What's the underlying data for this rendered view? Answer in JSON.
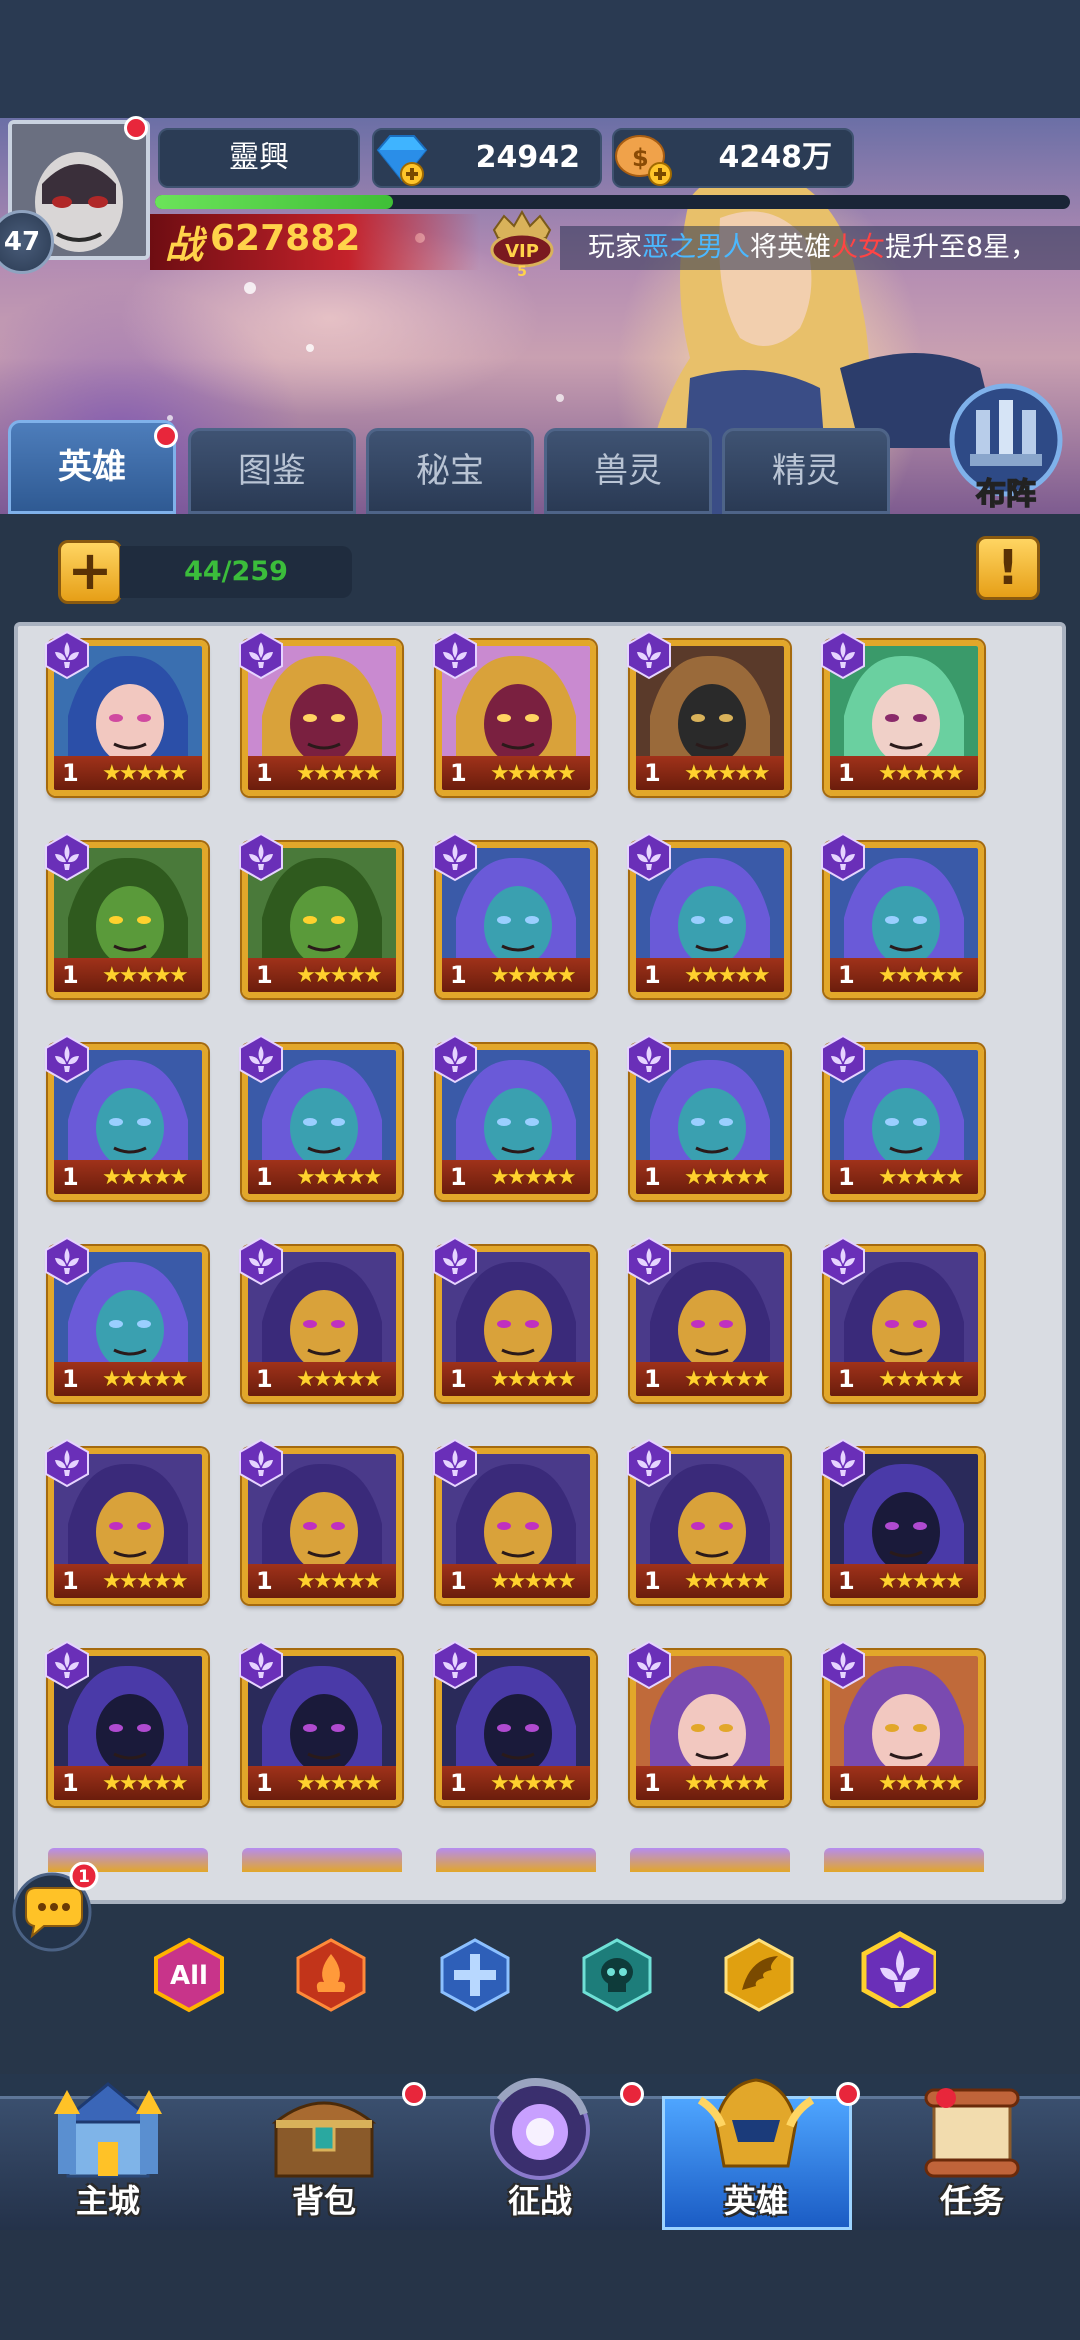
{
  "player": {
    "name": "靈興",
    "level": "47",
    "diamonds": "24942",
    "gold": "4248万",
    "power_label": "战",
    "power": "627882",
    "vip": "VIP",
    "vip_level": "5",
    "xp_fraction": 0.26
  },
  "ticker": {
    "prefix": "玩家",
    "player": "恶之男人",
    "middle": "将英雄",
    "hero": "火女",
    "suffix": "提升至8星，"
  },
  "tabs": [
    {
      "label": "英雄",
      "active": true,
      "badge": true
    },
    {
      "label": "图鉴",
      "active": false
    },
    {
      "label": "秘宝",
      "active": false
    },
    {
      "label": "兽灵",
      "active": false
    },
    {
      "label": "精灵",
      "active": false
    }
  ],
  "formation_label": "布阵",
  "hero_count": "44/259",
  "hero_grid": [
    [
      "naga-sorceress",
      "gold-mask-assassin",
      "gold-mask-assassin",
      "armored-knight",
      "green-haired-dryad"
    ],
    [
      "swamp-toad",
      "swamp-toad",
      "feather-witch",
      "feather-witch",
      "feather-witch"
    ],
    [
      "feather-witch",
      "feather-witch",
      "feather-witch",
      "feather-witch",
      "feather-witch"
    ],
    [
      "feather-witch",
      "hooded-masked-rogue",
      "hooded-masked-rogue",
      "hooded-masked-rogue",
      "hooded-masked-rogue"
    ],
    [
      "hooded-masked-rogue",
      "hooded-masked-rogue",
      "hooded-masked-rogue",
      "hooded-masked-rogue",
      "shadow-knight"
    ],
    [
      "shadow-knight",
      "shadow-knight",
      "shadow-knight",
      "crowned-priestess",
      "crowned-priestess"
    ]
  ],
  "hero_card": {
    "level": "1",
    "stars": "★★★★★"
  },
  "chat_badge": "1",
  "filters": [
    {
      "label": "All",
      "icon": "all-filter-icon"
    },
    {
      "label": "",
      "icon": "fire-faction-icon"
    },
    {
      "label": "",
      "icon": "cross-faction-icon"
    },
    {
      "label": "",
      "icon": "skull-faction-icon"
    },
    {
      "label": "",
      "icon": "wing-faction-icon"
    },
    {
      "label": "",
      "icon": "fleur-faction-icon"
    }
  ],
  "nav": [
    {
      "label": "主城",
      "badge": false,
      "active": false
    },
    {
      "label": "背包",
      "badge": true,
      "active": false
    },
    {
      "label": "征战",
      "badge": true,
      "active": false
    },
    {
      "label": "英雄",
      "badge": true,
      "active": true
    },
    {
      "label": "任务",
      "badge": false,
      "active": false
    }
  ],
  "colors": {
    "accent_gold": "#e2a72a",
    "xp_green": "#4fd443",
    "badge_red": "#e8263b"
  }
}
